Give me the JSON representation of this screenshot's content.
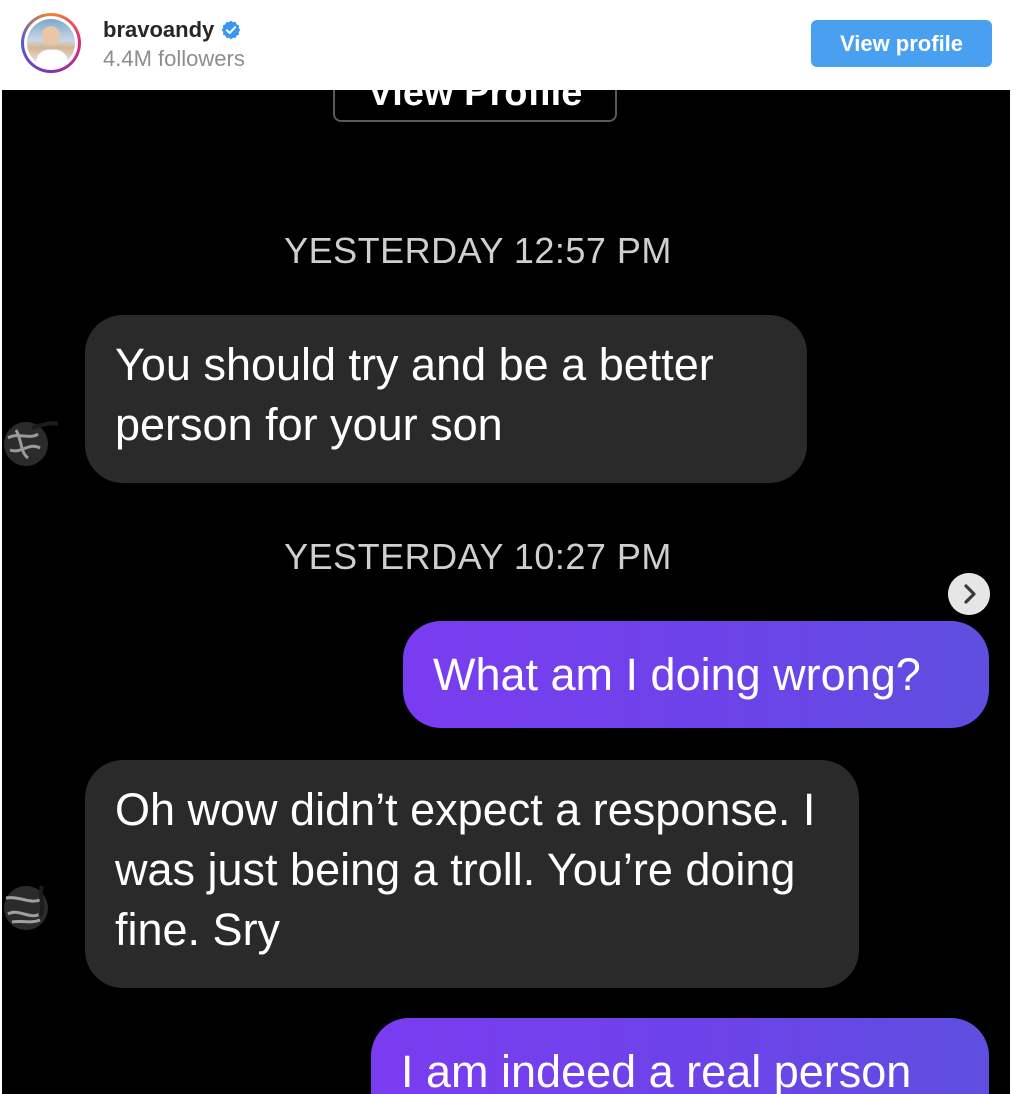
{
  "header": {
    "username": "bravoandy",
    "followers": "4.4M followers",
    "view_profile_label": "View profile",
    "verified_icon": "verified-badge-icon",
    "accent_color": "#4aa0f0"
  },
  "dm": {
    "top_button_label": "View Profile",
    "timestamps": [
      "YESTERDAY 12:57 PM",
      "YESTERDAY 10:27 PM"
    ],
    "messages": [
      {
        "direction": "incoming",
        "text": "You should try and be a better person for your son"
      },
      {
        "direction": "outgoing",
        "text": "What am I doing wrong?"
      },
      {
        "direction": "incoming",
        "text": "Oh wow didn’t expect a response. I was just being a troll. You’re doing fine. Sry"
      },
      {
        "direction": "outgoing",
        "text": "I am indeed a real person"
      }
    ],
    "colors": {
      "background": "#000000",
      "incoming_bubble": "#2a2a2a",
      "outgoing_bubble": "#6b44e8",
      "timestamp": "#cfcfcf"
    }
  }
}
